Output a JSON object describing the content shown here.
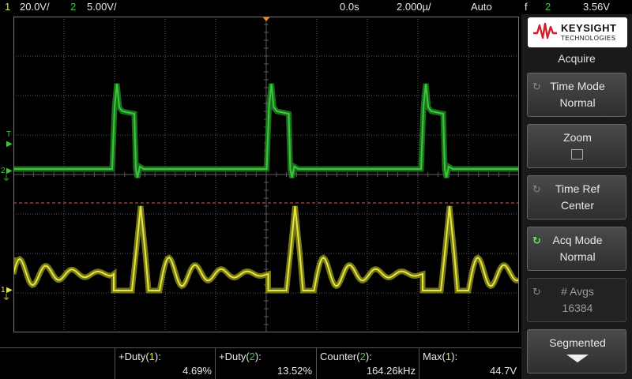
{
  "status": {
    "ch1_num": "1",
    "ch1_scale": "20.0V/",
    "ch2_num": "2",
    "ch2_scale": "5.00V/",
    "time_offset": "0.0s",
    "time_scale": "2.000µ/",
    "trigger_mode": "Auto",
    "trigger_slope": "f",
    "trigger_source": "2",
    "trigger_level": "3.56V"
  },
  "markers": {
    "trigger_marker": "T",
    "ch2_marker": "2",
    "ch1_marker": "1"
  },
  "measurements": [
    {
      "label_pre": "+Duty(",
      "label_ch": "1",
      "label_post": "):",
      "value": "4.69%"
    },
    {
      "label_pre": "+Duty(",
      "label_ch": "2",
      "label_post": "):",
      "value": "13.52%"
    },
    {
      "label_pre": "Counter(",
      "label_ch": "2",
      "label_post": "):",
      "value": "164.26kHz"
    },
    {
      "label_pre": "Max(",
      "label_ch": "1",
      "label_post": "):",
      "value": "44.7V"
    }
  ],
  "panel": {
    "brand_name": "KEYSIGHT",
    "brand_sub": "TECHNOLOGIES",
    "menu_title": "Acquire",
    "softkeys": {
      "time_mode": {
        "label": "Time Mode",
        "value": "Normal"
      },
      "zoom": {
        "label": "Zoom"
      },
      "time_ref": {
        "label": "Time Ref",
        "value": "Center"
      },
      "acq_mode": {
        "label": "Acq Mode",
        "value": "Normal"
      },
      "avgs": {
        "label": "# Avgs",
        "value": "16384"
      },
      "segmented": {
        "label": "Segmented"
      }
    }
  },
  "colors": {
    "ch1": "#e6e63c",
    "ch2": "#3cc83c",
    "grid": "#5a5a5a",
    "trigger_line": "#e05a5a",
    "trigger_pointer": "#f08c28"
  }
}
